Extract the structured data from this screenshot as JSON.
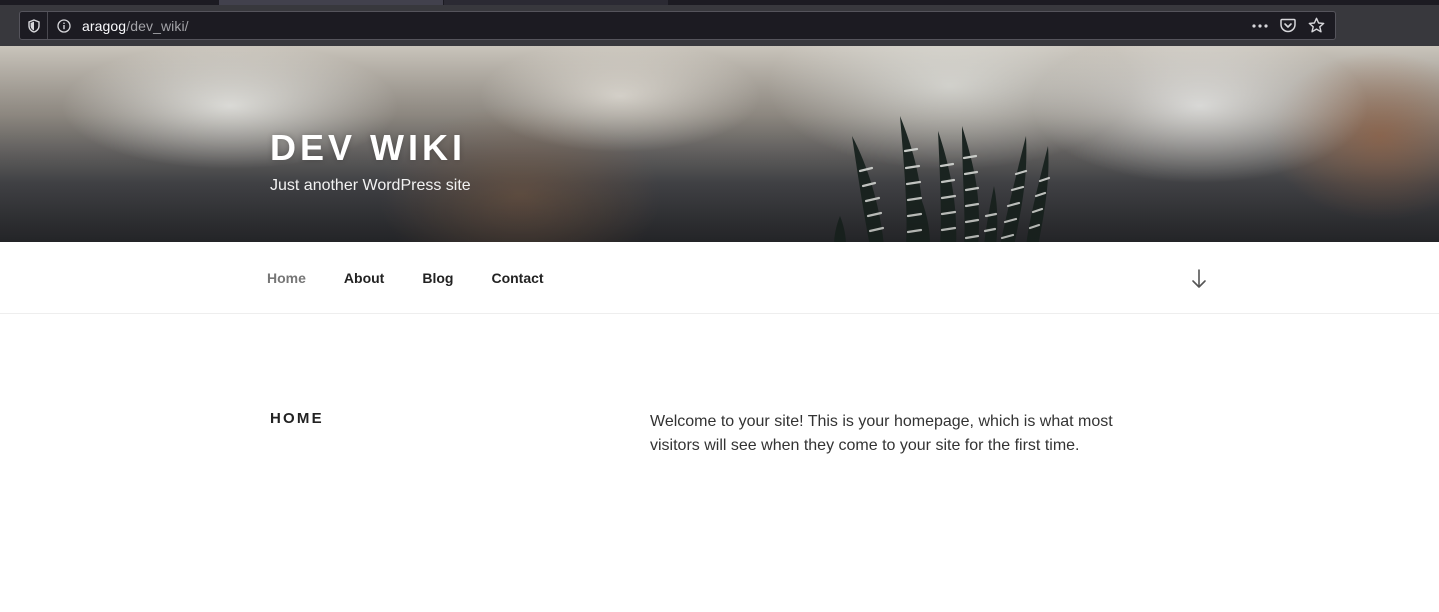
{
  "browser": {
    "url_host": "aragog",
    "url_path": "/dev_wiki/",
    "icons": {
      "tracking": "shield-icon",
      "site_info": "info-icon",
      "more": "more-dots-icon",
      "pocket": "pocket-icon",
      "bookmark": "star-icon"
    }
  },
  "header": {
    "site_title": "DEV WIKI",
    "tagline": "Just another WordPress site"
  },
  "nav": {
    "items": [
      {
        "label": "Home",
        "current": true
      },
      {
        "label": "About",
        "current": false
      },
      {
        "label": "Blog",
        "current": false
      },
      {
        "label": "Contact",
        "current": false
      }
    ],
    "scroll_icon": "arrow-down-icon"
  },
  "content": {
    "title": "HOME",
    "body": "Welcome to your site! This is your homepage, which is what most visitors will see when they come to your site for the first time."
  },
  "colors": {
    "chrome_bg": "#38383d",
    "urlbar_bg": "#1c1b22",
    "text_dark": "#222222",
    "nav_current": "#767676"
  }
}
